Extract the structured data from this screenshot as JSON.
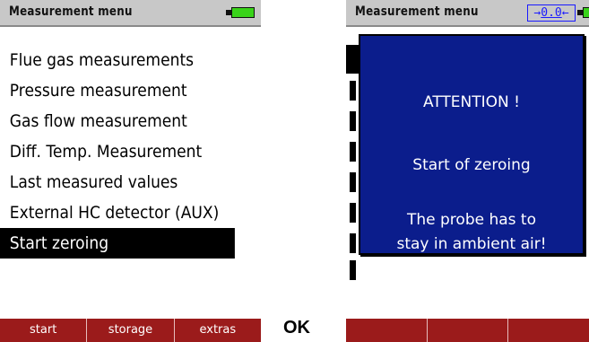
{
  "left_screen": {
    "title": "Measurement menu",
    "menu_items": [
      "Flue gas measurements",
      "Pressure measurement",
      "Gas flow measurement",
      "Diff. Temp. Measurement",
      "Last measured values",
      "External HC detector (AUX)",
      "Start zeroing"
    ],
    "selected_index": 6,
    "softkeys": [
      "start",
      "storage",
      "extras"
    ]
  },
  "between_label": "OK",
  "right_screen": {
    "title": "Measurement menu",
    "zero_indicator": {
      "arrow_left": "→",
      "value": "0.0",
      "arrow_right": "←"
    },
    "dialog": {
      "heading": "ATTENTION !",
      "line1": "Start of zeroing",
      "line2": "The probe has to",
      "line3": "stay in ambient air!"
    },
    "softkey_labels": [
      "",
      "",
      ""
    ]
  },
  "colors": {
    "softkey_bar": "#9b1b1b",
    "dialog_bg": "#0b1d8c",
    "battery": "#39d31a",
    "zero_box": "#1a1aff",
    "titlebar": "#c8c8c8"
  },
  "icons": {
    "battery": "battery-full-icon"
  }
}
